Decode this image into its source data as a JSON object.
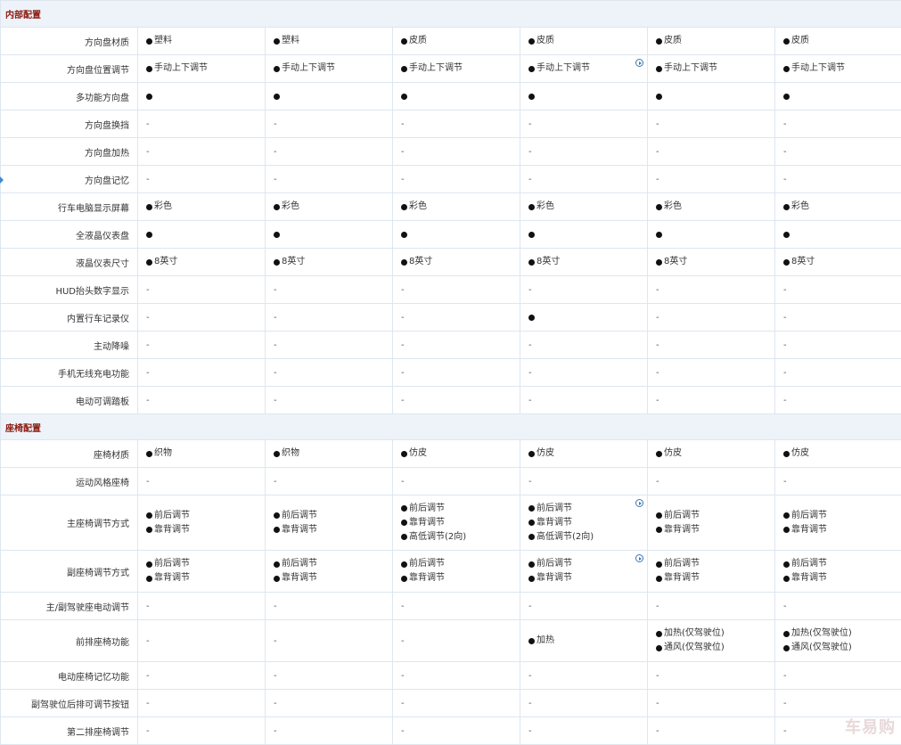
{
  "sections": [
    {
      "title": "内部配置",
      "rows": [
        {
          "label": "方向盘材质",
          "height": 31,
          "cells": [
            [
              "塑料"
            ],
            [
              "塑料"
            ],
            [
              "皮质"
            ],
            [
              "皮质"
            ],
            [
              "皮质"
            ],
            [
              "皮质"
            ]
          ]
        },
        {
          "label": "方向盘位置调节",
          "height": 31,
          "cells": [
            [
              "手动上下调节"
            ],
            [
              "手动上下调节"
            ],
            [
              "手动上下调节"
            ],
            [
              "手动上下调节"
            ],
            [
              "手动上下调节"
            ],
            [
              "手动上下调节"
            ]
          ],
          "play_col": 3
        },
        {
          "label": "多功能方向盘",
          "height": 31,
          "cells": [
            [
              ""
            ],
            [
              ""
            ],
            [
              ""
            ],
            [
              ""
            ],
            [
              ""
            ],
            [
              ""
            ]
          ]
        },
        {
          "label": "方向盘换挡",
          "height": 31,
          "cells": [
            "-",
            "-",
            "-",
            "-",
            "-",
            "-"
          ]
        },
        {
          "label": "方向盘加热",
          "height": 31,
          "cells": [
            "-",
            "-",
            "-",
            "-",
            "-",
            "-"
          ]
        },
        {
          "label": "方向盘记忆",
          "height": 31,
          "cells": [
            "-",
            "-",
            "-",
            "-",
            "-",
            "-"
          ]
        },
        {
          "label": "行车电脑显示屏幕",
          "height": 31,
          "cells": [
            [
              "彩色"
            ],
            [
              "彩色"
            ],
            [
              "彩色"
            ],
            [
              "彩色"
            ],
            [
              "彩色"
            ],
            [
              "彩色"
            ]
          ]
        },
        {
          "label": "全液晶仪表盘",
          "height": 31,
          "cells": [
            [
              ""
            ],
            [
              ""
            ],
            [
              ""
            ],
            [
              ""
            ],
            [
              ""
            ],
            [
              ""
            ]
          ]
        },
        {
          "label": "液晶仪表尺寸",
          "height": 31,
          "cells": [
            [
              "8英寸"
            ],
            [
              "8英寸"
            ],
            [
              "8英寸"
            ],
            [
              "8英寸"
            ],
            [
              "8英寸"
            ],
            [
              "8英寸"
            ]
          ]
        },
        {
          "label": "HUD抬头数字显示",
          "height": 31,
          "cells": [
            "-",
            "-",
            "-",
            "-",
            "-",
            "-"
          ]
        },
        {
          "label": "内置行车记录仪",
          "height": 31,
          "cells": [
            "-",
            "-",
            "-",
            [
              ""
            ],
            "-",
            "-"
          ]
        },
        {
          "label": "主动降噪",
          "height": 31,
          "cells": [
            "-",
            "-",
            "-",
            "-",
            "-",
            "-"
          ]
        },
        {
          "label": "手机无线充电功能",
          "height": 31,
          "cells": [
            "-",
            "-",
            "-",
            "-",
            "-",
            "-"
          ]
        },
        {
          "label": "电动可调踏板",
          "height": 31,
          "cells": [
            "-",
            "-",
            "-",
            "-",
            "-",
            "-"
          ]
        }
      ]
    },
    {
      "title": "座椅配置",
      "rows": [
        {
          "label": "座椅材质",
          "height": 31,
          "cells": [
            [
              "织物"
            ],
            [
              "织物"
            ],
            [
              "仿皮"
            ],
            [
              "仿皮"
            ],
            [
              "仿皮"
            ],
            [
              "仿皮"
            ]
          ]
        },
        {
          "label": "运动风格座椅",
          "height": 31,
          "cells": [
            "-",
            "-",
            "-",
            "-",
            "-",
            "-"
          ]
        },
        {
          "label": "主座椅调节方式",
          "height": 62,
          "cells": [
            [
              "前后调节",
              "靠背调节"
            ],
            [
              "前后调节",
              "靠背调节"
            ],
            [
              "前后调节",
              "靠背调节",
              "高低调节(2向)"
            ],
            [
              "前后调节",
              "靠背调节",
              "高低调节(2向)"
            ],
            [
              "前后调节",
              "靠背调节"
            ],
            [
              "前后调节",
              "靠背调节"
            ]
          ],
          "play_col": 3
        },
        {
          "label": "副座椅调节方式",
          "height": 47,
          "cells": [
            [
              "前后调节",
              "靠背调节"
            ],
            [
              "前后调节",
              "靠背调节"
            ],
            [
              "前后调节",
              "靠背调节"
            ],
            [
              "前后调节",
              "靠背调节"
            ],
            [
              "前后调节",
              "靠背调节"
            ],
            [
              "前后调节",
              "靠背调节"
            ]
          ],
          "play_col": 3
        },
        {
          "label": "主/副驾驶座电动调节",
          "height": 31,
          "cells": [
            "-",
            "-",
            "-",
            "-",
            "-",
            "-"
          ]
        },
        {
          "label": "前排座椅功能",
          "height": 47,
          "cells": [
            "-",
            "-",
            "-",
            [
              "加热"
            ],
            [
              "加热(仅驾驶位)",
              "通风(仅驾驶位)"
            ],
            [
              "加热(仅驾驶位)",
              "通风(仅驾驶位)"
            ]
          ]
        },
        {
          "label": "电动座椅记忆功能",
          "height": 31,
          "cells": [
            "-",
            "-",
            "-",
            "-",
            "-",
            "-"
          ]
        },
        {
          "label": "副驾驶位后排可调节按钮",
          "height": 31,
          "cells": [
            "-",
            "-",
            "-",
            "-",
            "-",
            "-"
          ]
        },
        {
          "label": "第二排座椅调节",
          "height": 31,
          "cells": [
            "-",
            "-",
            "-",
            "-",
            "-",
            "-"
          ]
        }
      ]
    }
  ],
  "watermark": "车易购"
}
